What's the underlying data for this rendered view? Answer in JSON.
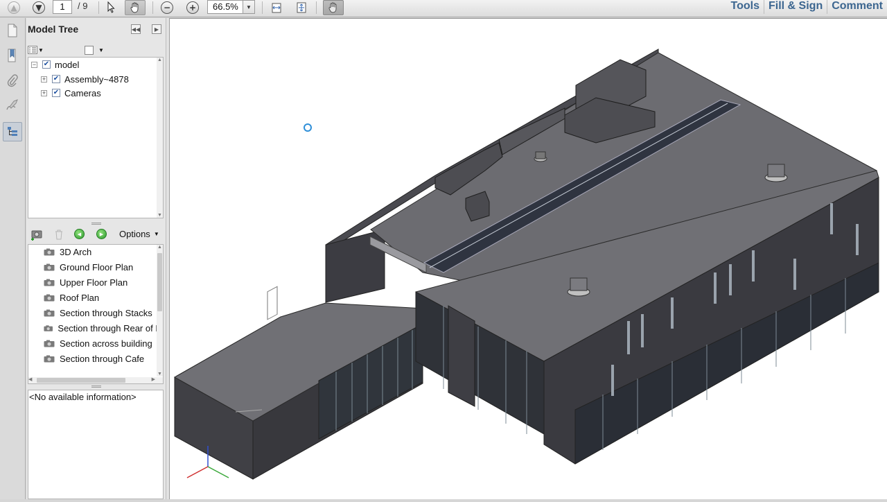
{
  "toolbar": {
    "page_current": "1",
    "page_total": "/ 9",
    "zoom": "66.5%",
    "links": [
      "Tools",
      "Fill & Sign",
      "Comment"
    ]
  },
  "rail_icons": [
    "pages-icon",
    "bookmark-icon",
    "attachment-icon",
    "signature-icon",
    "model-tree-icon"
  ],
  "model_tree": {
    "title": "Model Tree",
    "items": [
      {
        "label": "model",
        "expander": "−",
        "checked": true
      },
      {
        "label": "Assembly~4878",
        "expander": "+",
        "checked": true
      },
      {
        "label": "Cameras",
        "expander": "+",
        "checked": true
      }
    ]
  },
  "views": {
    "options_label": "Options",
    "items": [
      "3D Arch",
      "Ground Floor Plan",
      "Upper Floor Plan",
      "Roof Plan",
      "Section through Stacks",
      "Section through Rear of E",
      "Section across building",
      "Section through Cafe"
    ]
  },
  "info": {
    "text": "<No available information>"
  },
  "colors": {
    "link": "#3c6690",
    "roof": "#6a6a6f",
    "wall": "#3d3d42",
    "glass": "#2b2f36"
  }
}
